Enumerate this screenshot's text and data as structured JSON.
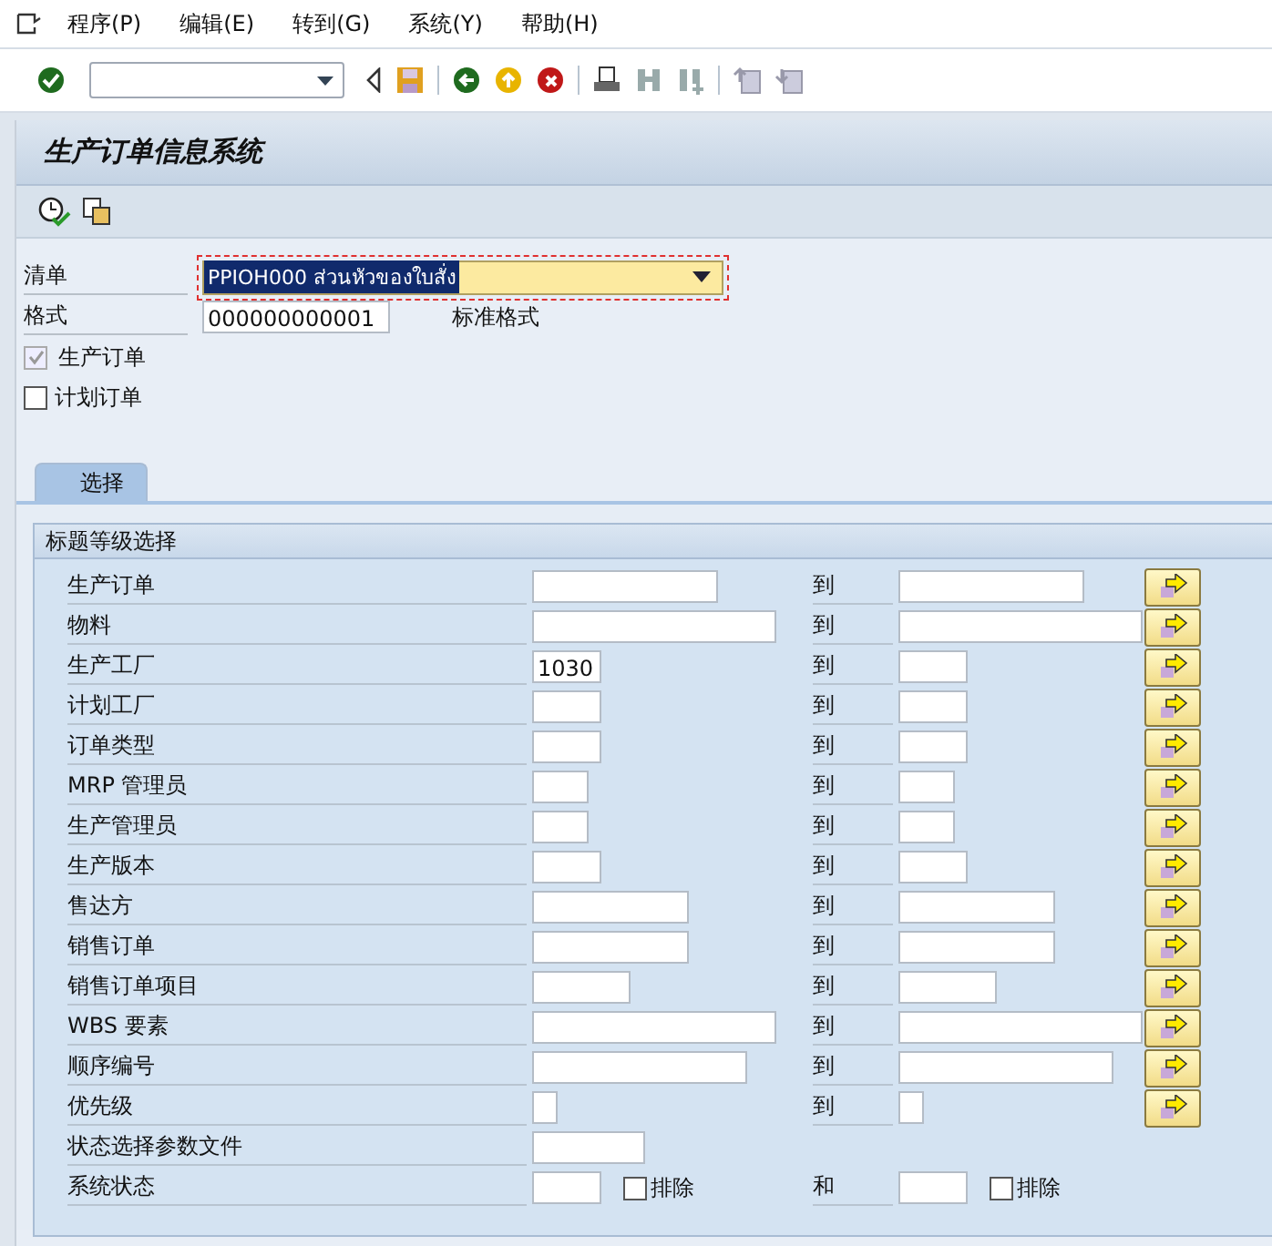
{
  "menu": [
    {
      "label": "程序(P)"
    },
    {
      "label": "编辑(E)"
    },
    {
      "label": "转到(G)"
    },
    {
      "label": "系统(Y)"
    },
    {
      "label": "帮助(H)"
    }
  ],
  "title": "生产订单信息系统",
  "list_field": {
    "label": "清单",
    "value": "PPIOH000 ส่วนหัวของใบสั่ง"
  },
  "layout_field": {
    "label": "格式",
    "value": "000000000001",
    "description": "标准格式"
  },
  "checkboxes": [
    {
      "label": "生产订单",
      "checked": true,
      "disabled": true
    },
    {
      "label": "计划订单",
      "checked": false,
      "disabled": false
    }
  ],
  "tabs": [
    {
      "label": "选择",
      "selected": true
    }
  ],
  "group": {
    "title": "标题等级选择",
    "rows": [
      {
        "kind": "range",
        "label": "生产订单",
        "to_label": "到"
      },
      {
        "kind": "range",
        "label": "物料",
        "to_label": "到"
      },
      {
        "kind": "range",
        "label": "生产工厂",
        "value": "1030",
        "to_label": "到"
      },
      {
        "kind": "range",
        "label": "计划工厂",
        "to_label": "到"
      },
      {
        "kind": "range",
        "label": "订单类型",
        "to_label": "到"
      },
      {
        "kind": "range",
        "label": "MRP 管理员",
        "to_label": "到"
      },
      {
        "kind": "range",
        "label": "生产管理员",
        "to_label": "到"
      },
      {
        "kind": "range",
        "label": "生产版本",
        "to_label": "到"
      },
      {
        "kind": "range",
        "label": "售达方",
        "to_label": "到"
      },
      {
        "kind": "range",
        "label": "销售订单",
        "to_label": "到"
      },
      {
        "kind": "range",
        "label": "销售订单项目",
        "to_label": "到"
      },
      {
        "kind": "range",
        "label": "WBS 要素",
        "to_label": "到"
      },
      {
        "kind": "range",
        "label": "顺序编号",
        "to_label": "到"
      },
      {
        "kind": "range",
        "label": "优先级",
        "to_label": "到"
      },
      {
        "kind": "single",
        "label": "状态选择参数文件"
      },
      {
        "kind": "status",
        "label": "系统状态",
        "to_label": "和",
        "exclude_label": "排除",
        "exclude_checked": false,
        "exclude2_label": "排除",
        "exclude2_checked": false
      }
    ]
  }
}
